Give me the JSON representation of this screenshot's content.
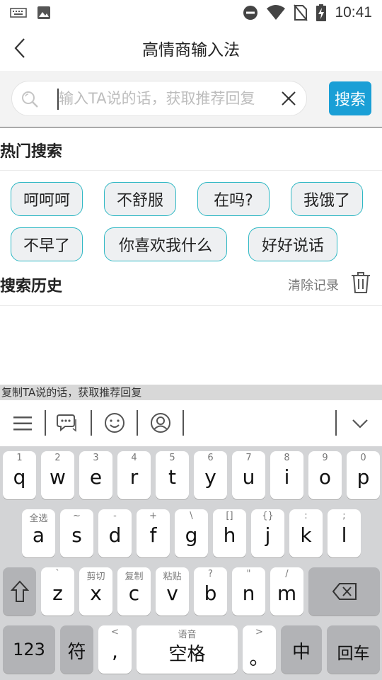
{
  "status_bar": {
    "time": "10:41"
  },
  "title_bar": {
    "title": "高情商输入法"
  },
  "search": {
    "placeholder": "输入TA说的话，获取推荐回复",
    "button_label": "搜索"
  },
  "hot": {
    "title": "热门搜索",
    "tags": [
      "呵呵呵",
      "不舒服",
      "在吗?",
      "我饿了",
      "不早了",
      "你喜欢我什么",
      "好好说话"
    ]
  },
  "history": {
    "title": "搜索历史",
    "clear_label": "清除记录"
  },
  "clipboard": {
    "text": "复制TA说的话，获取推荐回复"
  },
  "keyboard": {
    "row1": [
      {
        "hint": "1",
        "key": "q"
      },
      {
        "hint": "2",
        "key": "w"
      },
      {
        "hint": "3",
        "key": "e"
      },
      {
        "hint": "4",
        "key": "r"
      },
      {
        "hint": "5",
        "key": "t"
      },
      {
        "hint": "6",
        "key": "y"
      },
      {
        "hint": "7",
        "key": "u"
      },
      {
        "hint": "8",
        "key": "i"
      },
      {
        "hint": "9",
        "key": "o"
      },
      {
        "hint": "0",
        "key": "p"
      }
    ],
    "row2": [
      {
        "hint": "全选",
        "key": "a"
      },
      {
        "hint": "~",
        "key": "s"
      },
      {
        "hint": "-",
        "key": "d"
      },
      {
        "hint": "+",
        "key": "f"
      },
      {
        "hint": "\\",
        "key": "g"
      },
      {
        "hint": "[]",
        "key": "h"
      },
      {
        "hint": "{}",
        "key": "j"
      },
      {
        "hint": ":",
        "key": "k"
      },
      {
        "hint": ";",
        "key": "l"
      }
    ],
    "row3": [
      {
        "hint": "`",
        "key": "z"
      },
      {
        "hint": "剪切",
        "key": "x"
      },
      {
        "hint": "复制",
        "key": "c"
      },
      {
        "hint": "粘贴",
        "key": "v"
      },
      {
        "hint": "?",
        "key": "b"
      },
      {
        "hint": "\"",
        "key": "n"
      },
      {
        "hint": "/",
        "key": "m"
      }
    ],
    "row4": {
      "num": "123",
      "sym": "符",
      "comma": ",",
      "comma_hint": "<",
      "space_hint": "语音",
      "space": "空格",
      "period": "。",
      "period_hint": ">",
      "lang": "中",
      "enter": "回车"
    }
  },
  "colors": {
    "accent": "#1a9fd6",
    "chip_border": "#2fb8c4"
  }
}
